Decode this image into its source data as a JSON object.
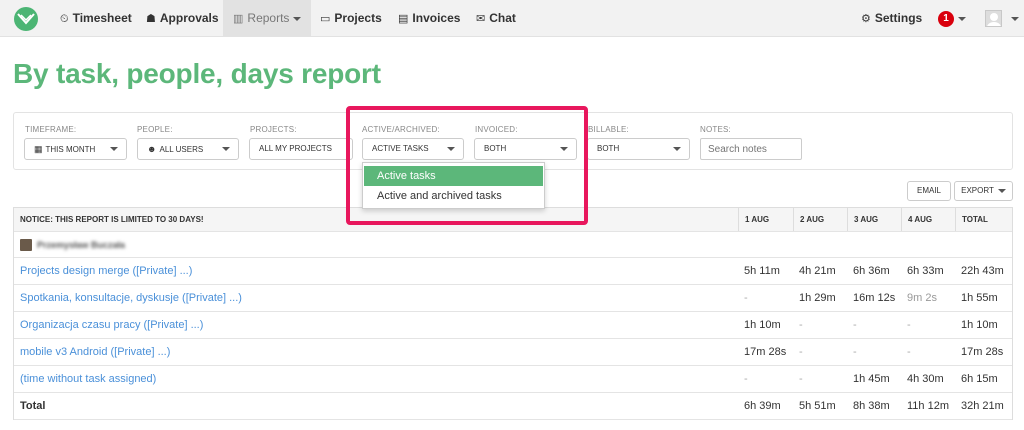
{
  "nav": {
    "items": [
      {
        "label": "Timesheet",
        "icon": "clock-icon"
      },
      {
        "label": "Approvals",
        "icon": "thumbs-up-icon"
      },
      {
        "label": "Reports",
        "icon": "bar-chart-icon"
      },
      {
        "label": "Projects",
        "icon": "folder-icon"
      },
      {
        "label": "Invoices",
        "icon": "file-icon"
      },
      {
        "label": "Chat",
        "icon": "chat-icon"
      }
    ],
    "settings_label": "Settings",
    "notification_count": "1"
  },
  "page_title": "By task, people, days report",
  "filters": {
    "timeframe": {
      "label": "TIMEFRAME:",
      "value": "THIS MONTH"
    },
    "people": {
      "label": "PEOPLE:",
      "value": "ALL USERS"
    },
    "projects": {
      "label": "PROJECTS:",
      "value": "ALL MY PROJECTS"
    },
    "active_archived": {
      "label": "ACTIVE/ARCHIVED:",
      "value": "ACTIVE TASKS"
    },
    "invoiced": {
      "label": "INVOICED:",
      "value": "BOTH"
    },
    "billable": {
      "label": "BILLABLE:",
      "value": "BOTH"
    },
    "notes": {
      "label": "NOTES:",
      "placeholder": "Search notes"
    }
  },
  "dropdown": {
    "options": [
      "Active tasks",
      "Active and archived tasks"
    ],
    "selected": "Active tasks"
  },
  "actions": {
    "email": "EMAIL",
    "export": "EXPORT"
  },
  "table": {
    "notice": "NOTICE: THIS REPORT IS LIMITED TO 30 DAYS!",
    "columns": [
      "1 AUG",
      "2 AUG",
      "3 AUG",
      "4 AUG",
      "TOTAL"
    ],
    "user_name": "Przemysław Buczała",
    "rows": [
      {
        "task": "Projects design merge ([Private] ...)",
        "cells": [
          "5h 11m",
          "4h 21m",
          "6h 36m",
          "6h 33m",
          "22h 43m"
        ]
      },
      {
        "task": "Spotkania, konsultacje, dyskusje ([Private] ...)",
        "cells": [
          "-",
          "1h 29m",
          "16m 12s",
          "9m 2s",
          "1h 55m"
        ]
      },
      {
        "task": "Organizacja czasu pracy ([Private] ...)",
        "cells": [
          "1h 10m",
          "-",
          "-",
          "-",
          "1h 10m"
        ]
      },
      {
        "task": "mobile v3 Android ([Private] ...)",
        "cells": [
          "17m 28s",
          "-",
          "-",
          "-",
          "17m 28s"
        ]
      },
      {
        "task": "(time without task assigned)",
        "cells": [
          "-",
          "-",
          "1h 45m",
          "4h 30m",
          "6h 15m"
        ]
      }
    ],
    "total": {
      "label": "Total",
      "cells": [
        "6h 39m",
        "5h 51m",
        "8h 38m",
        "11h 12m",
        "32h 21m"
      ]
    }
  },
  "colors": {
    "accent": "#5cb77a",
    "highlight": "#e8175d",
    "link": "#4a90d9",
    "badge": "#d9000d"
  }
}
